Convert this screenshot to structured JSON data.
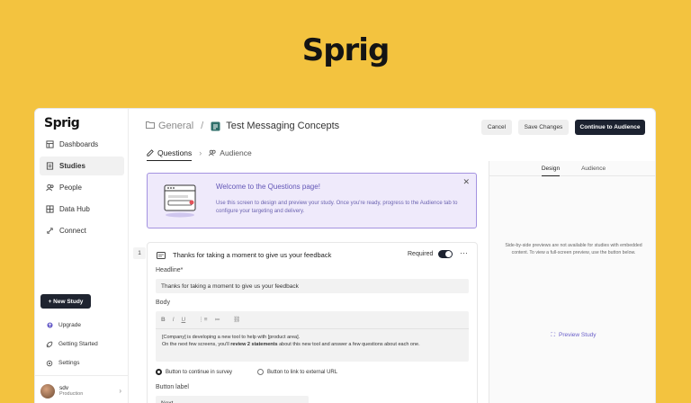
{
  "brand": {
    "name": "Sprig"
  },
  "sidebar": {
    "logo": "Sprig",
    "items": [
      {
        "label": "Dashboards",
        "icon": "dashboard-icon"
      },
      {
        "label": "Studies",
        "icon": "studies-icon",
        "active": true
      },
      {
        "label": "People",
        "icon": "people-icon"
      },
      {
        "label": "Data Hub",
        "icon": "data-hub-icon"
      },
      {
        "label": "Connect",
        "icon": "connect-icon"
      }
    ],
    "new_study_label": "+ New Study",
    "links": [
      {
        "label": "Upgrade",
        "icon": "upgrade-icon"
      },
      {
        "label": "Getting Started",
        "icon": "rocket-icon"
      },
      {
        "label": "Settings",
        "icon": "gear-icon"
      }
    ],
    "user": {
      "name": "sdv",
      "org": "Production"
    }
  },
  "header": {
    "breadcrumb_root": "General",
    "breadcrumb_sep": "/",
    "study_title": "Test Messaging Concepts",
    "cancel_label": "Cancel",
    "save_label": "Save Changes",
    "continue_label": "Continue to Audience"
  },
  "tabs": [
    {
      "label": "Questions",
      "active": true
    },
    {
      "label": "Audience",
      "active": false
    }
  ],
  "welcome": {
    "title": "Welcome to the Questions page!",
    "body": "Use this screen to design and preview your study. Once you're ready, progress to the Audience tab to configure your targeting and delivery.",
    "close": "✕"
  },
  "question": {
    "number": "1",
    "title": "Thanks for taking a moment to give us your feedback",
    "required_label": "Required",
    "more": "···",
    "headline_label": "Headline*",
    "headline_value": "Thanks for taking a moment to give us your feedback",
    "body_label": "Body",
    "toolbar": {
      "bold": "B",
      "italic": "I",
      "underline": "U",
      "ordered": "⋮≡",
      "bullets": "≔",
      "link": "⛓"
    },
    "body_line1": "[Company] is developing a new tool to help with [product area].",
    "body_line2_pre": "On the next few screens, you'll ",
    "body_line2_bold": "review 2 statements",
    "body_line2_post": " about this new tool and answer a few questions about each one.",
    "radio_continue": "Button to continue in survey",
    "radio_external": "Button to link to external URL",
    "button_label_label": "Button label",
    "button_label_value": "Next"
  },
  "right_panel": {
    "tabs": [
      "Design",
      "Audience"
    ],
    "note": "Side-by-side previews are not available for studies with embedded content. To view a full-screen preview, use the button below.",
    "preview_label": "Preview Study",
    "preview_icon": "expand-icon"
  },
  "colors": {
    "background": "#F3C33F",
    "primary": "#1c2230",
    "accent": "#6357b7"
  }
}
